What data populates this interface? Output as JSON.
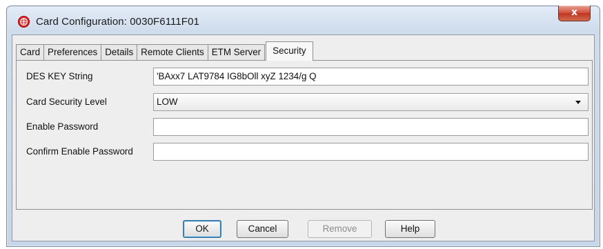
{
  "window": {
    "title": "Card Configuration: 0030F6111F01",
    "close_label": "x",
    "app_icon": "network-globe-icon",
    "colors": {
      "title_bar": "#cfdcec",
      "close_button": "#c8402b",
      "app_icon": "#e02020"
    }
  },
  "tabs": [
    {
      "label": "Card",
      "active": false
    },
    {
      "label": "Preferences",
      "active": false
    },
    {
      "label": "Details",
      "active": false
    },
    {
      "label": "Remote Clients",
      "active": false
    },
    {
      "label": "ETM Server",
      "active": false
    },
    {
      "label": "Security",
      "active": true
    }
  ],
  "form": {
    "des_key": {
      "label": "DES KEY String",
      "value": "'BAxx7 LAT9784 IG8bOll xyZ 1234/g Q"
    },
    "security_level": {
      "label": "Card Security Level",
      "value": "LOW",
      "icon": "dropdown-arrow-icon"
    },
    "enable_password": {
      "label": "Enable Password",
      "value": ""
    },
    "confirm_password": {
      "label": "Confirm Enable Password",
      "value": ""
    }
  },
  "buttons": {
    "ok": {
      "label": "OK",
      "enabled": true,
      "default": true
    },
    "cancel": {
      "label": "Cancel",
      "enabled": true
    },
    "remove": {
      "label": "Remove",
      "enabled": false
    },
    "help": {
      "label": "Help",
      "enabled": true
    }
  }
}
